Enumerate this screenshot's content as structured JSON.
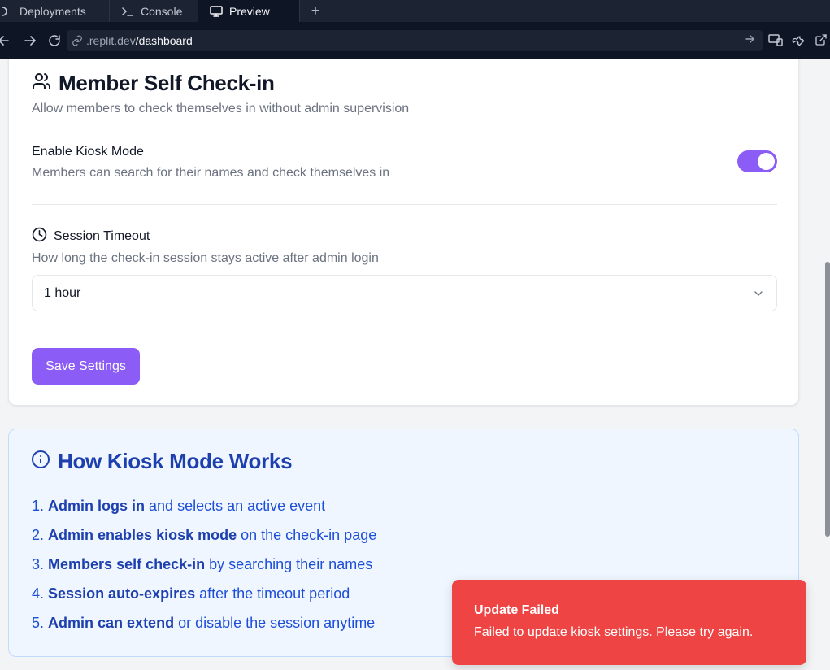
{
  "browser": {
    "tabs": [
      {
        "label": "Deployments",
        "icon": "deployments-icon"
      },
      {
        "label": "Console",
        "icon": "terminal-icon"
      },
      {
        "label": "Preview",
        "icon": "monitor-icon"
      }
    ],
    "url_domain": ".replit.dev",
    "url_path": "/dashboard"
  },
  "settings": {
    "title": "Member Self Check-in",
    "subtitle": "Allow members to check themselves in without admin supervision",
    "kiosk_label": "Enable Kiosk Mode",
    "kiosk_description": "Members can search for their names and check themselves in",
    "kiosk_enabled": true,
    "timeout_label": "Session Timeout",
    "timeout_description": "How long the check-in session stays active after admin login",
    "timeout_value": "1 hour",
    "save_label": "Save Settings"
  },
  "info": {
    "title": "How Kiosk Mode Works",
    "steps": [
      {
        "num": "1.",
        "bold": "Admin logs in",
        "rest": " and selects an active event"
      },
      {
        "num": "2.",
        "bold": "Admin enables kiosk mode",
        "rest": " on the check-in page"
      },
      {
        "num": "3.",
        "bold": "Members self check-in",
        "rest": " by searching their names"
      },
      {
        "num": "4.",
        "bold": "Session auto-expires",
        "rest": " after the timeout period"
      },
      {
        "num": "5.",
        "bold": "Admin can extend",
        "rest": " or disable the session anytime"
      }
    ]
  },
  "toast": {
    "title": "Update Failed",
    "message": "Failed to update kiosk settings. Please try again."
  },
  "colors": {
    "accent": "#8b5cf6",
    "info_text": "#1e40af",
    "toast_bg": "#ef4444"
  }
}
